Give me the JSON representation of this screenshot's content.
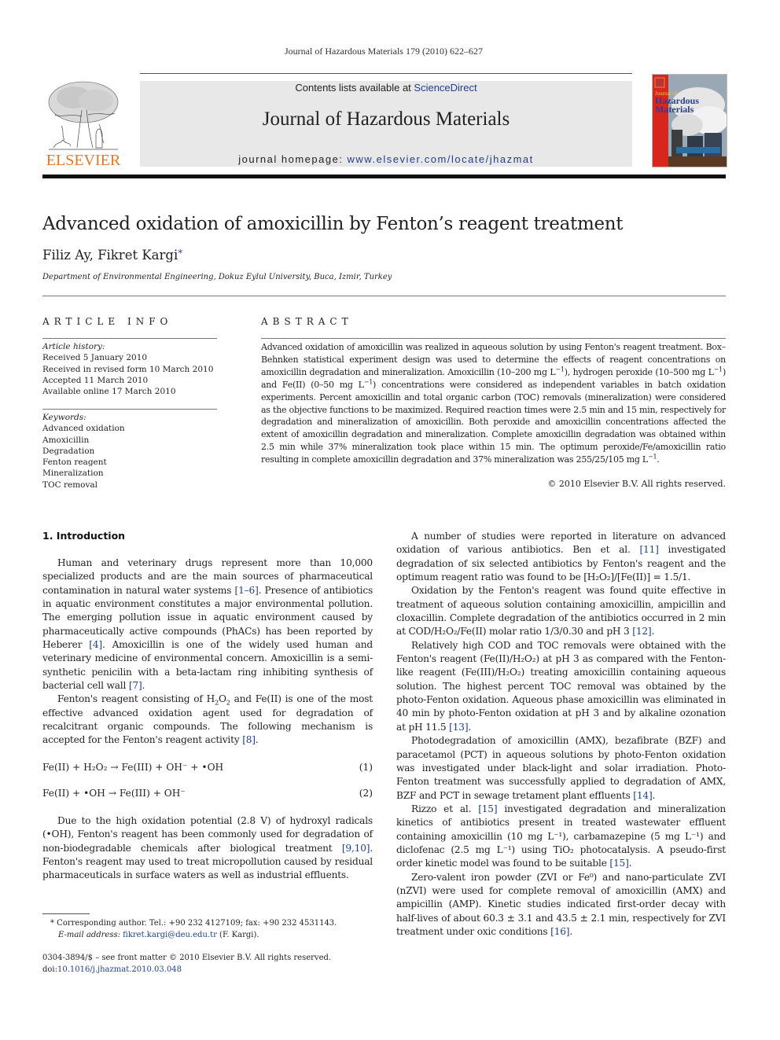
{
  "header": {
    "journal_ref": "Journal of Hazardous Materials 179 (2010) 622–627",
    "contents_prefix": "Contents lists available at ",
    "contents_link": "ScienceDirect",
    "journal_title": "Journal of Hazardous Materials",
    "homepage_prefix": "journal homepage: ",
    "homepage_url": "www.elsevier.com/locate/jhazmat",
    "publisher_logo_text": "ELSEVIER",
    "cover": {
      "line1": "Journal of",
      "line2": "Hazardous",
      "line3": "Materials"
    }
  },
  "article": {
    "title": "Advanced oxidation of amoxicillin by Fenton’s reagent treatment",
    "authors": "Filiz Ay, Fikret Kargi",
    "author_marker": "*",
    "affiliation": "Department of Environmental Engineering, Dokuz Eylul University, Buca, Izmir, Turkey"
  },
  "article_info": {
    "heading": "ARTICLE INFO",
    "history_label": "Article history:",
    "history": [
      "Received 5 January 2010",
      "Received in revised form 10 March 2010",
      "Accepted 11 March 2010",
      "Available online 17 March 2010"
    ],
    "keywords_label": "Keywords:",
    "keywords": [
      "Advanced oxidation",
      "Amoxicillin",
      "Degradation",
      "Fenton reagent",
      "Mineralization",
      "TOC removal"
    ]
  },
  "abstract": {
    "heading": "ABSTRACT",
    "text_parts": {
      "p1": "Advanced oxidation of amoxicillin was realized in aqueous solution by using Fenton's reagent treatment. Box–Behnken statistical experiment design was used to determine the effects of reagent concentrations on amoxicillin degradation and mineralization. Amoxicillin (10–200 mg L",
      "p2": "), hydrogen peroxide (10–500 mg L",
      "p3": ") and Fe(II) (0–50 mg L",
      "p4": ") concentrations were considered as independent variables in batch oxidation experiments. Percent amoxicillin and total organic carbon (TOC) removals (mineralization) were considered as the objective functions to be maximized. Required reaction times were 2.5 min and 15 min, respectively for degradation and mineralization of amoxicillin. Both peroxide and amoxicillin concentrations affected the extent of amoxicillin degradation and mineralization. Complete amoxicillin degradation was obtained within 2.5 min while 37% mineralization took place within 15 min. The optimum peroxide/Fe/amoxicillin ratio resulting in complete amoxicillin degradation and 37% mineralization was 255/25/105 mg L",
      "p5": ".",
      "exp": "−1"
    },
    "copyright": "© 2010 Elsevier B.V. All rights reserved."
  },
  "introduction": {
    "heading": "1.  Introduction",
    "para1": {
      "a": "Human and veterinary drugs represent more than 10,000 specialized products and are the main sources of pharmaceutical contamination in natural water systems ",
      "ref1": "[1–6]",
      "b": ". Presence of antibiotics in aquatic environment constitutes a major environmental pollution. The emerging pollution issue in aquatic environment caused by pharmaceutically active compounds (PhACs) has been reported by Heberer ",
      "ref2": "[4]",
      "c": ". Amoxicillin is one of the widely used human and veterinary medicine of environmental concern. Amoxicillin is a semi-synthetic penicilin with a beta-lactam ring inhibiting synthesis of bacterial cell wall ",
      "ref3": "[7]",
      "d": "."
    },
    "para2": {
      "a": "Fenton's reagent consisting of H",
      "b": "O",
      "c": " and Fe(II) is one of the most effective advanced oxidation agent used for degradation of recalcitrant organic compounds. The following mechanism is accepted for the Fenton's reagent activity ",
      "ref": "[8]",
      "d": ".",
      "sub": "2"
    },
    "equations": [
      {
        "lhs": "Fe(II) + H₂O₂ →  Fe(III) +  OH⁻ + •OH",
        "number": "(1)"
      },
      {
        "lhs": "Fe(II) + •OH  →  Fe(III) +  OH⁻",
        "number": "(2)"
      }
    ],
    "para3": {
      "a": "Due to the high oxidation potential (2.8 V) of hydroxyl radicals (•OH), Fenton's reagent has been commonly used for degradation of non-biodegradable chemicals after biological treatment ",
      "ref": "[9,10]",
      "b": ". Fenton's reagent may used to treat micropollution caused by residual pharmaceuticals in surface waters as well as industrial effluents."
    },
    "right": {
      "p1": {
        "a": "A number of studies were reported in literature on advanced oxidation of various antibiotics. Ben et al. ",
        "ref": "[11]",
        "b": " investigated degradation of six selected antibiotics by Fenton's reagent and the optimum reagent ratio was found to be [H₂O₂]/[Fe(II)] = 1.5/1."
      },
      "p2": {
        "a": "Oxidation by the Fenton's reagent was found quite effective in treatment of aqueous solution containing amoxicillin, ampicillin and cloxacillin. Complete degradation of the antibiotics occurred in 2 min at COD/H₂O₂/Fe(II) molar ratio 1/3/0.30 and pH 3 ",
        "ref": "[12]",
        "b": "."
      },
      "p3": {
        "a": "Relatively high COD and TOC removals were obtained with the Fenton's reagent (Fe(II)/H₂O₂) at pH 3 as compared with the Fenton-like reagent (Fe(III)/H₂O₂) treating amoxicillin containing aqueous solution. The highest percent TOC removal was obtained by the photo-Fenton oxidation. Aqueous phase amoxicillin was eliminated in 40 min by photo-Fenton oxidation at pH 3 and by alkaline ozonation at pH 11.5 ",
        "ref": "[13]",
        "b": "."
      },
      "p4": {
        "a": "Photodegradation of amoxicillin (AMX), bezafibrate (BZF) and paracetamol (PCT) in aqueous solutions by photo-Fenton oxidation was investigated under black-light and solar irradiation. Photo-Fenton treatment was successfully applied to degradation of AMX, BZF and PCT in sewage tretament plant effluents ",
        "ref": "[14]",
        "b": "."
      },
      "p5": {
        "a": "Rizzo et al. ",
        "ref1": "[15]",
        "b": " investigated degradation and mineralization kinetics of antibiotics present in treated wastewater effluent containing amoxicillin (10 mg L⁻¹), carbamazepine (5 mg L⁻¹) and diclofenac (2.5 mg L⁻¹) using TiO₂ photocatalysis. A pseudo-first order kinetic model was found to be suitable ",
        "ref2": "[15]",
        "c": "."
      },
      "p6": {
        "a": "Zero-valent iron powder (ZVI or Fe⁰) and nano-particulate ZVI (nZVI) were used for complete removal of amoxicillin (AMX) and ampicillin (AMP). Kinetic studies indicated first-order decay with half-lives of about 60.3 ± 3.1 and 43.5 ± 2.1 min, respectively for ZVI treatment under oxic conditions ",
        "ref": "[16]",
        "b": "."
      }
    }
  },
  "footnotes": {
    "corresponding": "*  Corresponding author. Tel.: +90 232 4127109; fax: +90 232 4531143.",
    "email_label": "E-mail address: ",
    "email": "fikret.kargi@deu.edu.tr",
    "email_suffix": " (F. Kargi).",
    "issn_line": "0304-3894/$ – see front matter © 2010 Elsevier B.V. All rights reserved.",
    "doi_label": "doi:",
    "doi": "10.1016/j.jhazmat.2010.03.048"
  },
  "colors": {
    "link": "#1f3f8f",
    "elsevier_orange": "#e87722",
    "masthead_bg": "#e8e8e8",
    "cover_red": "#d8261c"
  }
}
